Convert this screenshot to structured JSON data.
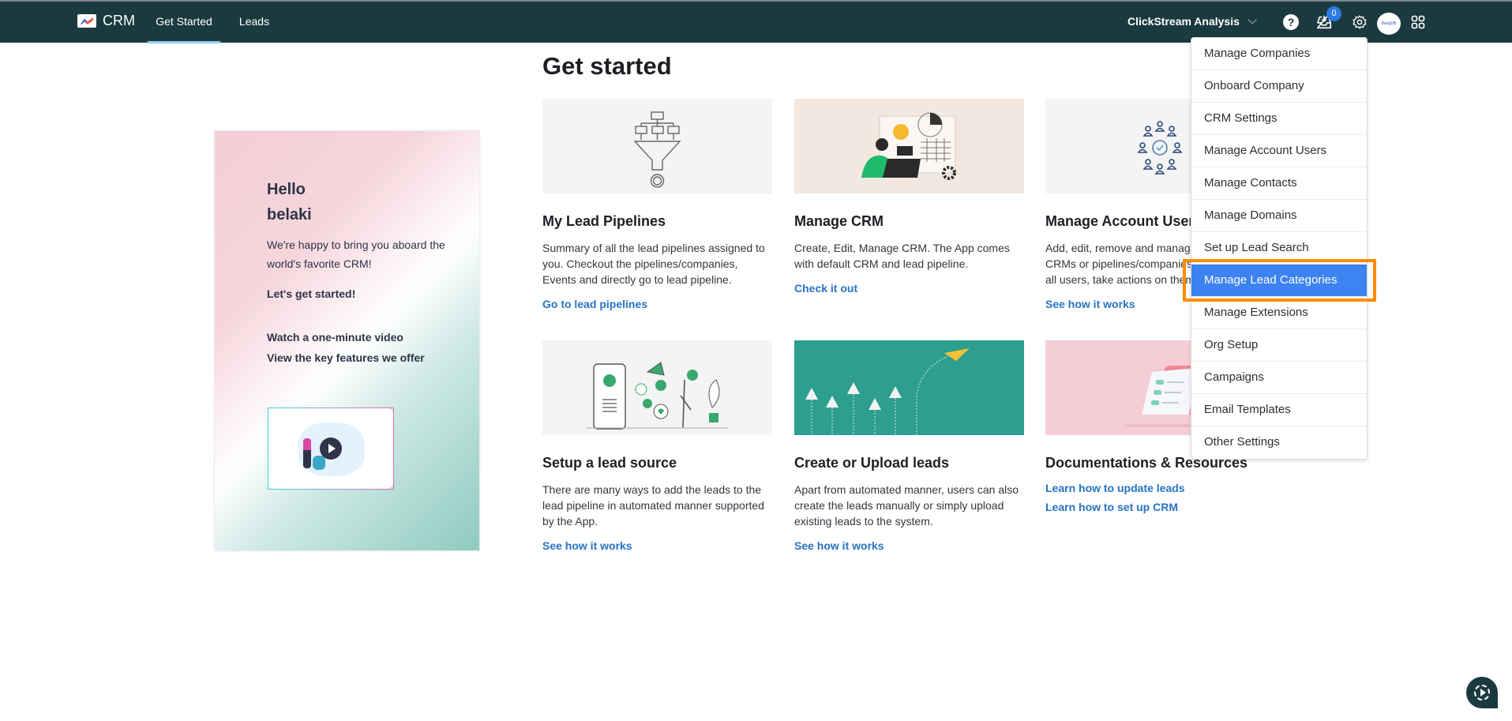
{
  "topbar": {
    "brand": "CRM",
    "tabs": [
      {
        "label": "Get Started",
        "active": true
      },
      {
        "label": "Leads",
        "active": false
      }
    ],
    "org_name": "ClickStream Analysis",
    "help_glyph": "?",
    "notification_count": "0",
    "avatar_text": "BangDB",
    "icons": [
      "help-icon",
      "inbox-download-icon",
      "gear-icon",
      "avatar",
      "apps-grid-icon"
    ]
  },
  "page": {
    "title": "Get started"
  },
  "welcome": {
    "hello": "Hello",
    "name": "belaki",
    "text": "We're happy to bring you aboard the world's favorite CRM!",
    "cta": "Let's get started!",
    "video_link": "Watch a one-minute video",
    "features_link": "View the key features we offer"
  },
  "cards": [
    {
      "title": "My Lead Pipelines",
      "description": "Summary of all the lead pipelines assigned to you. Checkout the pipelines/companies, Events and directly go to lead pipeline.",
      "links": [
        "Go to lead pipelines"
      ]
    },
    {
      "title": "Manage CRM",
      "description": "Create, Edit, Manage CRM. The App comes with default CRM and lead pipeline.",
      "links": [
        "Check it out"
      ]
    },
    {
      "title": "Manage Account Users",
      "description": "Add, edit, remove and manage users of the CRMs or pipelines/companies. See the list of all users, take actions on them.",
      "links": [
        "See how it works"
      ]
    },
    {
      "title": "Setup a lead source",
      "description": "There are many ways to add the leads to the lead pipeline in automated manner supported by the App.",
      "links": [
        "See how it works"
      ]
    },
    {
      "title": "Create or Upload leads",
      "description": "Apart from automated manner, users can also create the leads manually or simply upload existing leads to the system.",
      "links": [
        "See how it works"
      ]
    },
    {
      "title": "Documentations & Resources",
      "description": "",
      "links": [
        "Learn how to update leads",
        "Learn how to set up CRM"
      ]
    }
  ],
  "settings_menu": {
    "selected_index": 7,
    "items": [
      "Manage Companies",
      "Onboard Company",
      "CRM Settings",
      "Manage Account Users",
      "Manage Contacts",
      "Manage Domains",
      "Set up Lead Search",
      "Manage Lead Categories",
      "Manage Extensions",
      "Org Setup",
      "Campaigns",
      "Email Templates",
      "Other Settings"
    ]
  },
  "colors": {
    "topbar": "#1b3a40",
    "link": "#2673c4",
    "menu_selected": "#3c82f0",
    "highlight": "#ff8c00",
    "badge": "#2c7be5"
  }
}
